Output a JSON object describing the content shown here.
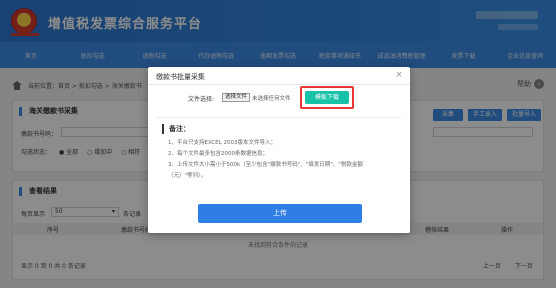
{
  "header": {
    "app_title": "增值税发票综合服务平台"
  },
  "nav": {
    "items": [
      "首页",
      "抵扣勾选",
      "退税勾选",
      "代办退税勾选",
      "逾期发票勾选",
      "税务事项通知书",
      "成品油消费税管理",
      "发票下载",
      "企业信息查询"
    ]
  },
  "page": {
    "breadcrumb_prefix": "当前位置：",
    "breadcrumb_path": "首页 > 抵扣勾选 > 海关缴款书",
    "help_label": "帮助",
    "search_panel": {
      "title": "海关缴款书采集",
      "field_label": "缴款书号码：",
      "status_label": "勾选状态：",
      "options": [
        "全部",
        "增加中",
        "相符"
      ],
      "btn_import": "采集",
      "btn_manual": "手工录入",
      "btn_batch": "批量导入"
    },
    "result_panel": {
      "title": "查看结果",
      "per_page_label": "每页显示",
      "per_page_value": "50",
      "per_page_suffix": "条记录",
      "columns": [
        "序号",
        "缴款书号码",
        "",
        "",
        "",
        "",
        "",
        "稽核结果",
        "操作"
      ],
      "empty_text": "未找到符合条件的记录",
      "footer_info": "显示 0 到 0 共 0 条记录",
      "prev": "上一页",
      "next": "下一页"
    }
  },
  "modal": {
    "title": "缴款书批量采集",
    "close": "×",
    "file_label": "文件选择:",
    "file_button": "选择文件",
    "file_status": "未选择任何文件",
    "download_button": "模板下载",
    "note_title": "备注：",
    "notes": [
      "1、平台只支持EXCEL 2003版本文件导入；",
      "2、每个文件最多包含2000条数据信息；",
      "3、上传文件大小需小于500k（至少包含\"缴款书号码\"、\"填发日期\"、\"税款金额",
      "（元）\"等列）。"
    ],
    "upload_button": "上传"
  }
}
